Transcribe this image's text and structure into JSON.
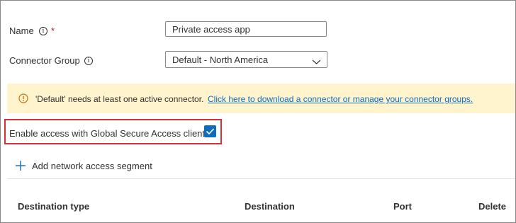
{
  "form": {
    "name_label": "Name",
    "name_required": "*",
    "name_value": "Private access app",
    "connector_group_label": "Connector Group",
    "connector_group_value": "Default - North America"
  },
  "warning": {
    "message": "'Default' needs at least one active connector.",
    "link": "Click here to download a connector or manage your connector groups."
  },
  "gsa": {
    "label": "Enable access with Global Secure Access client",
    "checked": true
  },
  "segments": {
    "add_label": "Add network access segment",
    "columns": [
      "Destination type",
      "Destination",
      "Port",
      "Delete"
    ]
  },
  "icons": {
    "info": "info-icon",
    "warning": "warning-icon",
    "chevron": "chevron-down-icon",
    "check": "checkmark-icon",
    "add": "plus-icon"
  },
  "colors": {
    "accent": "#0f6cbd",
    "warning_bg": "#fff4ce",
    "warning_icon": "#c4740c",
    "highlight_border": "#d13438",
    "required": "#a4262c"
  }
}
